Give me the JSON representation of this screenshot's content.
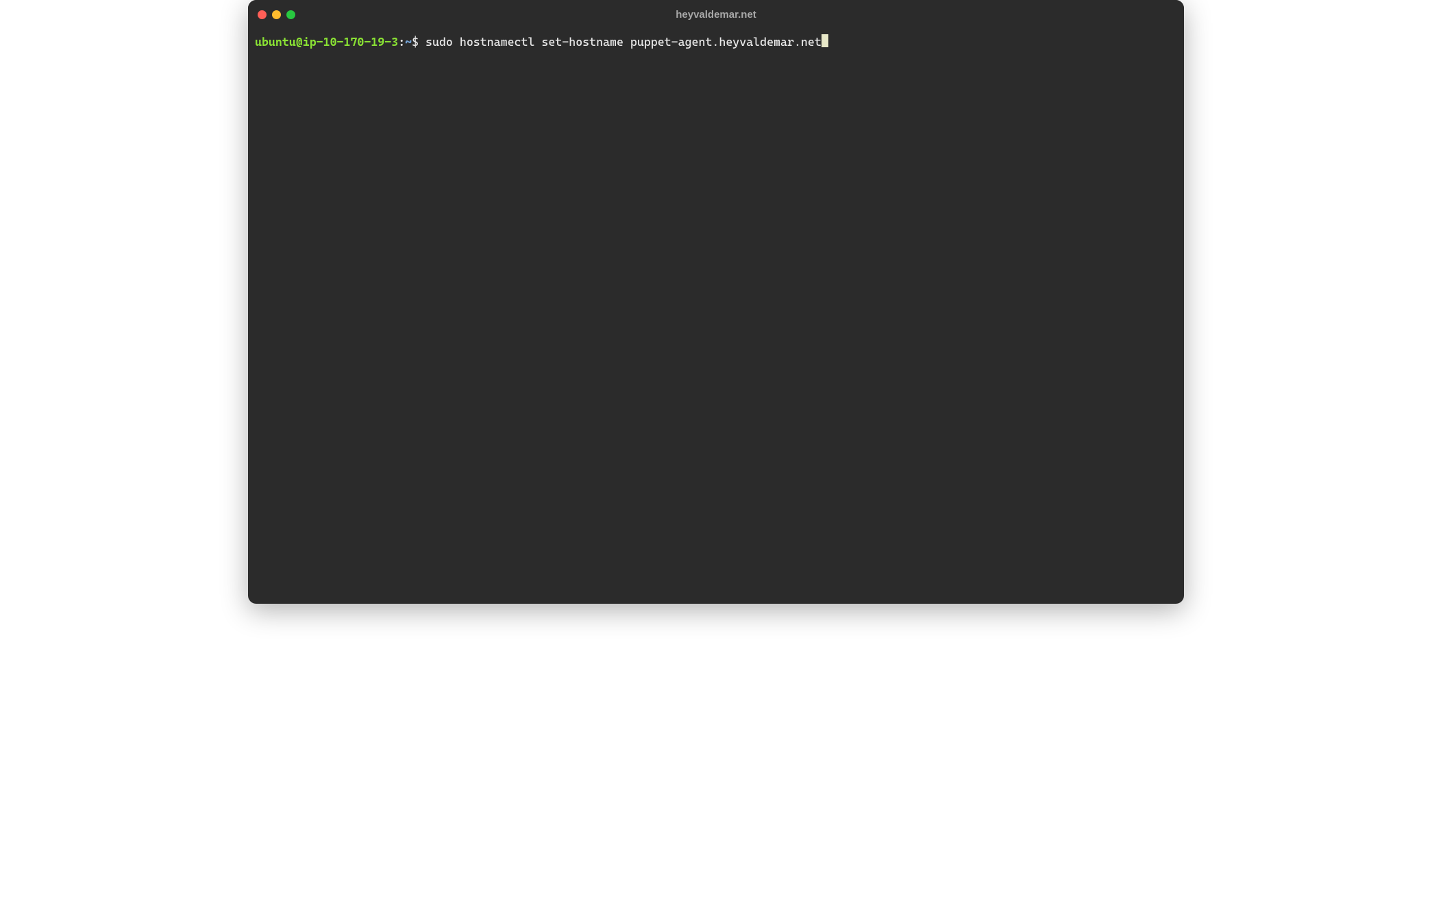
{
  "window": {
    "title": "heyvaldemar.net"
  },
  "traffic_lights": {
    "close": "close",
    "minimize": "minimize",
    "maximize": "maximize"
  },
  "prompt": {
    "user_host": "ubuntu@ip-10-170-19-3",
    "colon": ":",
    "path": "~",
    "symbol": "$ "
  },
  "command": "sudo hostnamectl set-hostname puppet-agent.heyvaldemar.net",
  "colors": {
    "background": "#2b2b2b",
    "prompt_user": "#8ae234",
    "prompt_path": "#729fcf",
    "text": "#e8e8e8",
    "cursor": "#e8e8c8",
    "red": "#ff5f57",
    "yellow": "#febc2e",
    "green": "#28c840"
  }
}
